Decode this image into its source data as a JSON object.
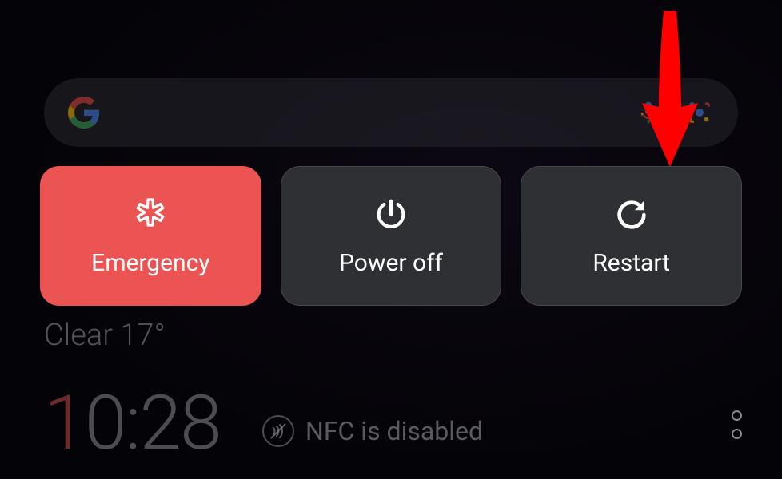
{
  "background": {
    "weather": "Clear 17°",
    "time": "10:28",
    "nfc_status": "NFC is disabled"
  },
  "power_menu": {
    "emergency": {
      "label": "Emergency",
      "icon": "medical-star"
    },
    "power_off": {
      "label": "Power off",
      "icon": "power"
    },
    "restart": {
      "label": "Restart",
      "icon": "restart"
    }
  },
  "annotation": {
    "arrow_target": "restart-button",
    "arrow_color": "#ff0000"
  },
  "colors": {
    "emergency_bg": "#ec5453",
    "card_bg": "#2f3033",
    "text": "#ffffff"
  }
}
